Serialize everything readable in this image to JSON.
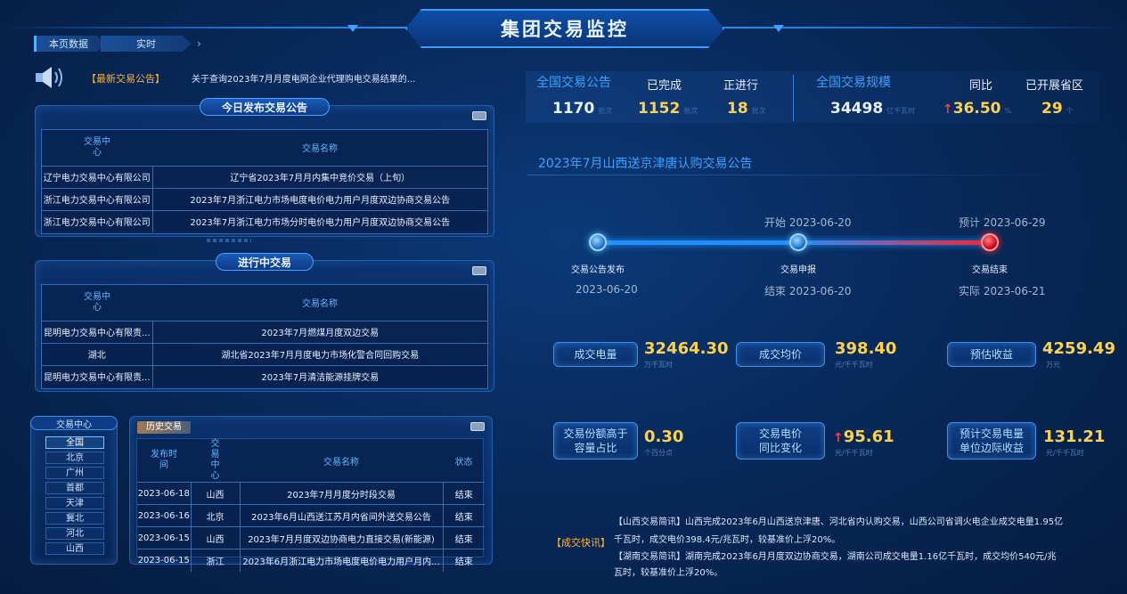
{
  "header": {
    "title": "集团交易监控"
  },
  "breadcrumb": {
    "items": [
      "本页数据",
      "实时"
    ],
    "next_icon": "chevron-right-icon"
  },
  "announcement": {
    "tag": "【最新交易公告】",
    "text": "关于查询2023年7月月度电网企业代理购电交易结果的..."
  },
  "today_panel": {
    "title": "今日发布交易公告",
    "headers": [
      "交易中心",
      "交易名称"
    ],
    "rows": [
      [
        "辽宁电力交易中心有限公司",
        "辽宁省2023年7月月内集中竞价交易（上旬）"
      ],
      [
        "浙江电力交易中心有限公司",
        "2023年7月浙江电力市场电度电价电力用户月度双边协商交易公告"
      ],
      [
        "浙江电力交易中心有限公司",
        "2023年7月浙江电力市场分时电价电力用户月度双边协商交易公告"
      ]
    ]
  },
  "ongoing_panel": {
    "title": "进行中交易",
    "headers": [
      "交易中心",
      "交易名称"
    ],
    "rows": [
      [
        "昆明电力交易中心有限责...",
        "2023年7月燃煤月度双边交易"
      ],
      [
        "湖北",
        "湖北省2023年7月月度电力市场化警合同回购交易"
      ],
      [
        "昆明电力交易中心有限责...",
        "2023年7月清洁能源挂牌交易"
      ]
    ]
  },
  "trade_centers": {
    "title": "交易中心",
    "items": [
      "全国",
      "北京",
      "广州",
      "首都",
      "天津",
      "冀北",
      "河北",
      "山西"
    ],
    "selected": "全国"
  },
  "history": {
    "title": "历史交易",
    "headers": [
      "发布时间",
      "交易中心",
      "交易名称",
      "状态"
    ],
    "rows": [
      [
        "2023-06-18",
        "山西",
        "2023年7月月度分时段交易",
        "结束"
      ],
      [
        "2023-06-16",
        "北京",
        "2023年6月山西送江苏月内省间外送交易公告",
        "结束"
      ],
      [
        "2023-06-15",
        "山西",
        "2023年7月月度双边协商电力直接交易(新能源)",
        "结束"
      ],
      [
        "2023-06-15",
        "浙江",
        "2023年6月浙江电力市场电度电价电力用户月内...",
        "结束"
      ]
    ]
  },
  "stats": {
    "announce_label": "全国交易公告",
    "done_label": "已完成",
    "ongoing_label": "正进行",
    "total": "1170",
    "done": "1152",
    "ongoing": "18",
    "count_unit": "批次",
    "scale_label": "全国交易规模",
    "yoy_label": "同比",
    "provinces_label": "已开展省区",
    "scale": "34498",
    "scale_unit": "亿千瓦时",
    "yoy": "36.50",
    "yoy_unit": "%",
    "provinces": "29",
    "provinces_unit": "个"
  },
  "notice": {
    "title": "2023年7月山西送京津唐认购交易公告",
    "steps": [
      {
        "label": "交易公告发布",
        "top": "",
        "bottom": "2023-06-20"
      },
      {
        "label": "交易申报",
        "top": "开始 2023-06-20",
        "bottom": "结束 2023-06-20"
      },
      {
        "label": "交易结束",
        "top": "预计 2023-06-29",
        "bottom": "实际 2023-06-21"
      }
    ]
  },
  "metrics": [
    {
      "label": "成交电量",
      "value": "32464.30",
      "unit": "万千瓦时"
    },
    {
      "label": "成交均价",
      "value": "398.40",
      "unit": "元/千千瓦时"
    },
    {
      "label": "预估收益",
      "value": "4259.49",
      "unit": "万元"
    },
    {
      "label": "交易份额高于容量占比",
      "value": "0.30",
      "unit": "个百分点"
    },
    {
      "label": "交易电价同比变化",
      "value": "95.61",
      "unit": "元/千千瓦时"
    },
    {
      "label": "预计交易电量单位边际收益",
      "value": "131.21",
      "unit": "元/千千瓦时"
    }
  ],
  "news": {
    "tag": "【成交快讯】",
    "lines": [
      "【山西交易简讯】山西完成2023年6月山西送京津唐、河北省内认购交易，山西公司省调火电企业成交电量1.95亿",
      "千瓦时，成交电价398.4元/兆瓦时，较基准价上浮20%。",
      "【湖南交易简讯】湖南完成2023年6月月度双边协商交易，湖南公司成交电量1.16亿千瓦时，成交均价540元/兆",
      "瓦时，较基准价上浮20%。"
    ]
  },
  "colors": {
    "accent": "#3aa0ff",
    "highlight": "#ffd24d",
    "warning": "#ffb338",
    "up": "#ff3b3b"
  }
}
